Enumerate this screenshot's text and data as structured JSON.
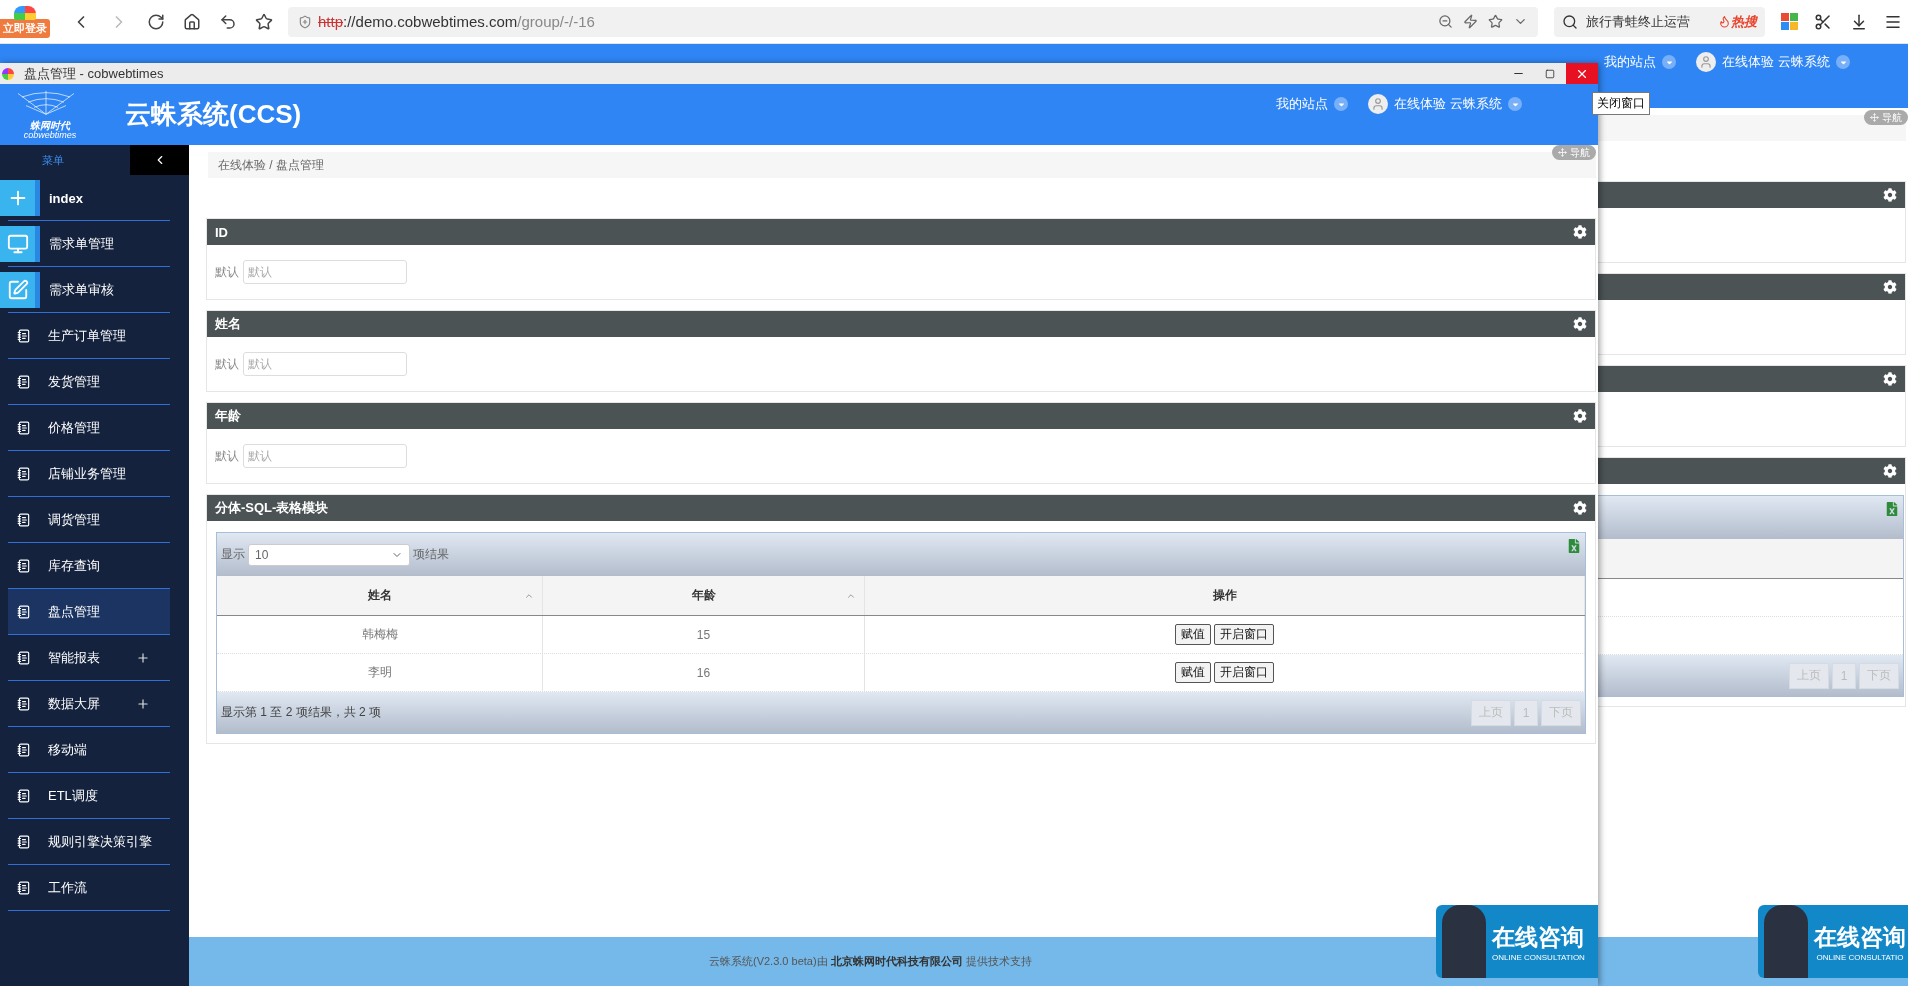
{
  "browser": {
    "login_badge": "立即登录",
    "url_scheme": "http",
    "url_host": "://demo.cobwebtimes.com",
    "url_path": "/group/-/-16",
    "search": {
      "placeholder": "旅行青蛙终止运营"
    },
    "hot_label": "热搜"
  },
  "background_page": {
    "site_menu": "我的站点",
    "user": "在线体验 云蛛系统",
    "nav_button": "导航",
    "pagination": [
      {
        "label": "上页",
        "disabled": true
      },
      {
        "label": "1",
        "disabled": true
      },
      {
        "label": "下页",
        "disabled": true
      }
    ],
    "consult": {
      "title": "在线咨询",
      "subtitle": "ONLINE CONSULTATIO"
    }
  },
  "window": {
    "title": "盘点管理 - cobwebtimes",
    "close_tooltip": "关闭窗口"
  },
  "header": {
    "logo_name": "蛛网时代",
    "logo_sub": "cobwebtimes",
    "app_title": "云蛛系统(CCS)",
    "site_menu": "我的站点",
    "user": "在线体验 云蛛系统"
  },
  "sidebar": {
    "menu_label": "菜单",
    "items": [
      {
        "label": "index",
        "kind": "tile",
        "selected": false,
        "expandable": false
      },
      {
        "label": "需求单管理",
        "kind": "tile",
        "selected": false,
        "expandable": false
      },
      {
        "label": "需求单审核",
        "kind": "tile",
        "selected": false,
        "expandable": false
      },
      {
        "label": "生产订单管理",
        "kind": "plain",
        "selected": false,
        "expandable": false
      },
      {
        "label": "发货管理",
        "kind": "plain",
        "selected": false,
        "expandable": false
      },
      {
        "label": "价格管理",
        "kind": "plain",
        "selected": false,
        "expandable": false
      },
      {
        "label": "店铺业务管理",
        "kind": "plain",
        "selected": false,
        "expandable": false
      },
      {
        "label": "调货管理",
        "kind": "plain",
        "selected": false,
        "expandable": false
      },
      {
        "label": "库存查询",
        "kind": "plain",
        "selected": false,
        "expandable": false
      },
      {
        "label": "盘点管理",
        "kind": "plain",
        "selected": true,
        "expandable": false
      },
      {
        "label": "智能报表",
        "kind": "plain",
        "selected": false,
        "expandable": true
      },
      {
        "label": "数据大屏",
        "kind": "plain",
        "selected": false,
        "expandable": true
      },
      {
        "label": "移动端",
        "kind": "plain",
        "selected": false,
        "expandable": false
      },
      {
        "label": "ETL调度",
        "kind": "plain",
        "selected": false,
        "expandable": false
      },
      {
        "label": "规则引擎决策引擎",
        "kind": "plain",
        "selected": false,
        "expandable": false
      },
      {
        "label": "工作流",
        "kind": "plain",
        "selected": false,
        "expandable": false
      }
    ]
  },
  "breadcrumb": "在线体验 / 盘点管理",
  "nav_button": "导航",
  "form_panels": [
    {
      "title": "ID",
      "label": "默认",
      "placeholder": "默认"
    },
    {
      "title": "姓名",
      "label": "默认",
      "placeholder": "默认"
    },
    {
      "title": "年龄",
      "label": "默认",
      "placeholder": "默认"
    }
  ],
  "table_panel": {
    "title": "分体-SQL-表格模块",
    "length_prefix": "显示",
    "length_value": "10",
    "length_suffix": "项结果",
    "columns": [
      {
        "label": "姓名",
        "sortable": true
      },
      {
        "label": "年龄",
        "sortable": true
      },
      {
        "label": "操作",
        "sortable": false
      }
    ],
    "rows": [
      {
        "cells": [
          "韩梅梅",
          "15"
        ],
        "actions": [
          "赋值",
          "开启窗口"
        ]
      },
      {
        "cells": [
          "李明",
          "16"
        ],
        "actions": [
          "赋值",
          "开启窗口"
        ]
      }
    ],
    "info": "显示第 1 至 2 项结果，共 2 项",
    "pagination": [
      {
        "label": "上页",
        "disabled": true
      },
      {
        "label": "1",
        "disabled": true
      },
      {
        "label": "下页",
        "disabled": true
      }
    ]
  },
  "footer": "云蛛系统(V2.3.0 beta)由 **北京蛛网时代科技有限公司** 提供技术支持",
  "consult": {
    "title": "在线咨询",
    "subtitle": "ONLINE CONSULTATION"
  }
}
